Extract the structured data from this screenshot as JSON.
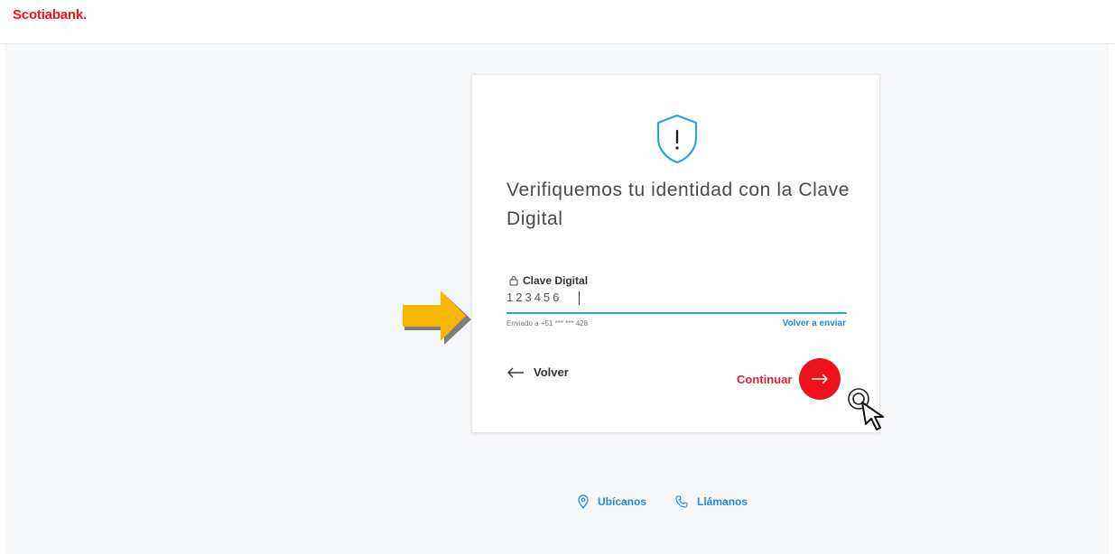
{
  "header": {
    "logo_text": "Scotiabank."
  },
  "card": {
    "icon": "shield-alert-icon",
    "title": "Verifiquemos tu identidad con la Clave Digital",
    "field": {
      "label": "Clave Digital",
      "icon": "lock-icon",
      "value": "123456"
    },
    "sent_to": "Enviado a +51 *** *** 428",
    "resend_label": "Volver a enviar",
    "back_label": "Volver",
    "continue_label": "Continuar"
  },
  "footer": {
    "links": [
      {
        "label": "Ubícanos",
        "icon": "location-pin-icon"
      },
      {
        "label": "Llámanos",
        "icon": "phone-icon"
      }
    ]
  },
  "colors": {
    "brand_red": "#ec111a",
    "link_blue": "#1f8bd3",
    "input_underline": "#2ea3d8",
    "annotation_arrow": "#f7b500"
  }
}
